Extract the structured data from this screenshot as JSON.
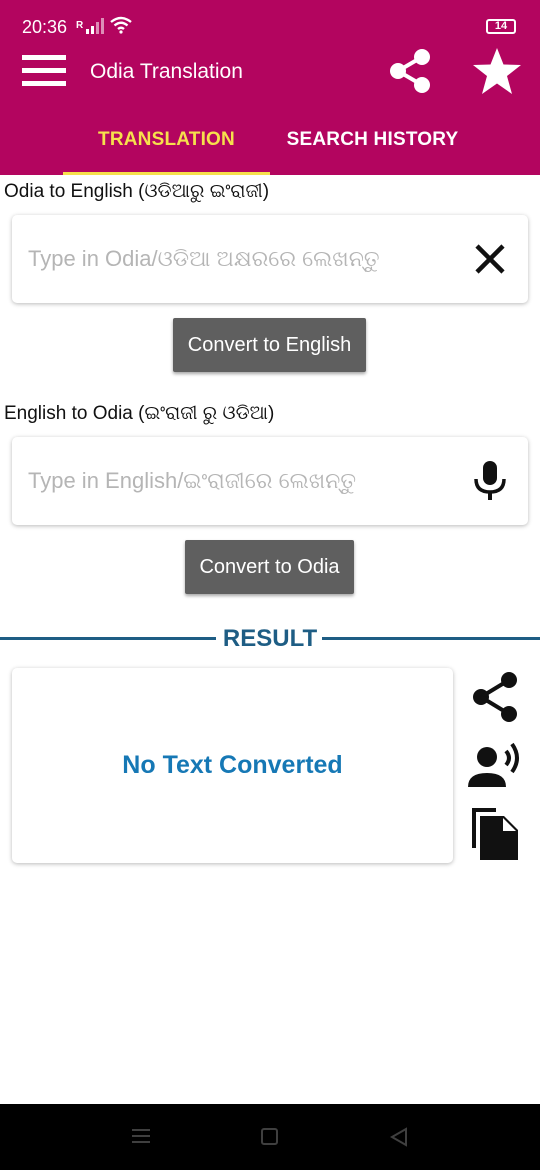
{
  "status_bar": {
    "time": "20:36",
    "signal_label": "R",
    "battery": "14"
  },
  "app_bar": {
    "title": "Odia Translation"
  },
  "tabs": [
    {
      "label": "TRANSLATION",
      "active": true
    },
    {
      "label": "SEARCH HISTORY",
      "active": false
    }
  ],
  "odia_to_english": {
    "label": "Odia to English (ଓଡିଆରୁ ଇଂରାଜୀ)",
    "placeholder": "Type in Odia/ଓଡିଆ ଅକ୍ଷରରେ ଲେଖନ୍ତୁ",
    "value": "",
    "button": "Convert to English"
  },
  "english_to_odia": {
    "label": "English to Odia (ଇଂରାଜୀ ରୁ ଓଡିଆ)",
    "placeholder": "Type in English/ଇଂରାଜୀରେ ଲେଖନ୍ତୁ",
    "value": "",
    "button": "Convert to Odia"
  },
  "result": {
    "title": "RESULT",
    "text": "No Text Converted"
  },
  "colors": {
    "primary": "#b3055f",
    "accent": "#f6e04c",
    "result_blue": "#1e5d84",
    "result_text": "#1678b5",
    "button_gray": "#5f5f5f"
  },
  "icons": {
    "menu": "menu-icon",
    "share": "share-icon",
    "favorite": "star-icon",
    "clear": "close-icon",
    "mic": "microphone-icon",
    "speak": "speaker-person-icon",
    "copy": "copy-icon"
  }
}
